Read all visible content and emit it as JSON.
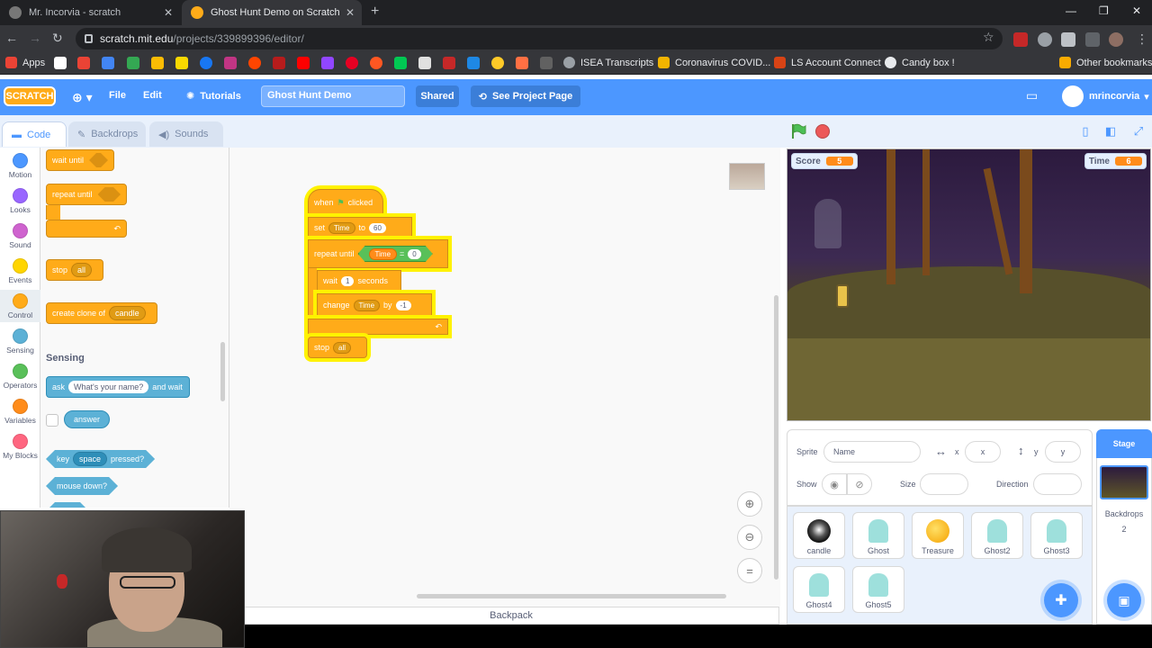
{
  "browser": {
    "tabs": [
      {
        "title": "Mr. Incorvia - scratch",
        "active": false
      },
      {
        "title": "Ghost Hunt Demo on Scratch",
        "active": true
      }
    ],
    "url_host": "scratch.mit.edu",
    "url_path": "/projects/339899396/editor/",
    "bookmarks": [
      "Apps",
      "ISEA Transcripts",
      "Coronavirus COVID...",
      "LS Account Connect",
      "Candy box !",
      "Other bookmarks"
    ]
  },
  "menubar": {
    "logo": "SCRATCH",
    "file": "File",
    "edit": "Edit",
    "tutorials": "Tutorials",
    "project_title": "Ghost Hunt Demo",
    "shared": "Shared",
    "see_project": "See Project Page",
    "username": "mrincorvia"
  },
  "editor_tabs": [
    "Code",
    "Backdrops",
    "Sounds"
  ],
  "categories": [
    {
      "label": "Motion",
      "color": "#4c97ff"
    },
    {
      "label": "Looks",
      "color": "#9966ff"
    },
    {
      "label": "Sound",
      "color": "#cf63cf"
    },
    {
      "label": "Events",
      "color": "#ffd500"
    },
    {
      "label": "Control",
      "color": "#ffab19"
    },
    {
      "label": "Sensing",
      "color": "#5cb1d6"
    },
    {
      "label": "Operators",
      "color": "#59c059"
    },
    {
      "label": "Variables",
      "color": "#ff8c1a"
    },
    {
      "label": "My Blocks",
      "color": "#ff6680"
    }
  ],
  "palette": {
    "wait_until": "wait until",
    "repeat_until": "repeat until",
    "stop": "stop",
    "stop_opt": "all",
    "create_clone": "create clone of",
    "clone_opt": "candle",
    "sensing_title": "Sensing",
    "ask": "ask",
    "ask_default": "What's your name?",
    "and_wait": "and wait",
    "answer": "answer",
    "key": "key",
    "key_opt": "space",
    "pressed": "pressed?",
    "mouse_down": "mouse down?"
  },
  "script": {
    "when": "when",
    "clicked": "clicked",
    "set": "set",
    "var_time": "Time",
    "to": "to",
    "set_value": "60",
    "repeat_until": "repeat until",
    "eq": "=",
    "eq_value": "0",
    "wait": "wait",
    "wait_value": "1",
    "seconds": "seconds",
    "change": "change",
    "by": "by",
    "change_value": "-1",
    "stop": "stop",
    "stop_opt": "all"
  },
  "backpack": "Backpack",
  "stage_monitors": [
    {
      "label": "Score",
      "value": "5"
    },
    {
      "label": "Time",
      "value": "6"
    }
  ],
  "sprite_info": {
    "sprite_label": "Sprite",
    "name_placeholder": "Name",
    "x_label": "x",
    "x_placeholder": "x",
    "y_label": "y",
    "y_placeholder": "y",
    "show_label": "Show",
    "size_label": "Size",
    "direction_label": "Direction"
  },
  "sprites": [
    "candle",
    "Ghost",
    "Treasure",
    "Ghost2",
    "Ghost3",
    "Ghost4",
    "Ghost5"
  ],
  "stage_pane": {
    "title": "Stage",
    "backdrops_label": "Backdrops",
    "backdrops_count": "2"
  }
}
